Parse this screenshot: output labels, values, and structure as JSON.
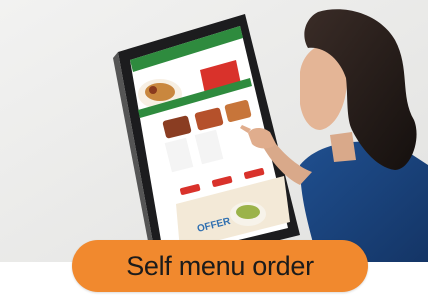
{
  "photo": {
    "subject": "woman touching a self-order kiosk touchscreen",
    "kiosk_screen": {
      "header_color": "#2e8b3e",
      "accent_color": "#d9322b",
      "buttons_count": 3,
      "banner_text": "OFFER"
    }
  },
  "cta": {
    "label": "Self menu order",
    "color": "#f1892e"
  }
}
